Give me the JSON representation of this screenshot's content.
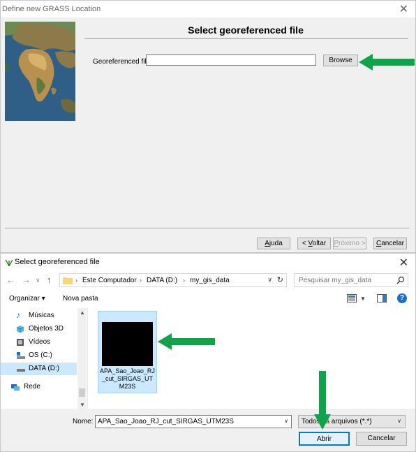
{
  "wizard": {
    "title": "Define new GRASS Location",
    "heading": "Select georeferenced file",
    "georef_label": "Georeferenced file:",
    "georef_value": "",
    "browse_label": "Browse",
    "buttons": {
      "help_first": "A",
      "help_rest": "juda",
      "back_first": "< ",
      "back_ul": "V",
      "back_rest": "oltar",
      "next_ul": "P",
      "next_rest": "róximo >",
      "cancel_ul": "C",
      "cancel_rest": "ancelar"
    }
  },
  "dialog": {
    "title": "Select georeferenced file",
    "breadcrumb": [
      "Este Computador",
      "DATA (D:)",
      "my_gis_data"
    ],
    "search_placeholder": "Pesquisar my_gis_data",
    "toolbar": {
      "organize": "Organizar ▾",
      "new_folder": "Nova pasta"
    },
    "nav_items": [
      {
        "label": "Músicas",
        "icon": "music-icon"
      },
      {
        "label": "Objetos 3D",
        "icon": "cube-icon"
      },
      {
        "label": "Vídeos",
        "icon": "video-icon"
      },
      {
        "label": "OS (C:)",
        "icon": "drive-icon"
      },
      {
        "label": "DATA (D:)",
        "icon": "drive-icon",
        "selected": true
      },
      {
        "label": "Rede",
        "icon": "network-icon"
      }
    ],
    "file": {
      "name": "APA_Sao_Joao_RJ_cut_SIRGAS_UTM23S",
      "display": "APA_Sao_Joao_RJ _cut_SIRGAS_UT M23S"
    },
    "name_label": "Nome:",
    "name_value": "APA_Sao_Joao_RJ_cut_SIRGAS_UTM23S",
    "file_type": "Todos os arquivos (*.*)",
    "open_label": "Abrir",
    "cancel_label": "Cancelar"
  },
  "colors": {
    "accent": "#0078d7",
    "arrow": "#10a34a",
    "selection": "#cce8ff"
  }
}
